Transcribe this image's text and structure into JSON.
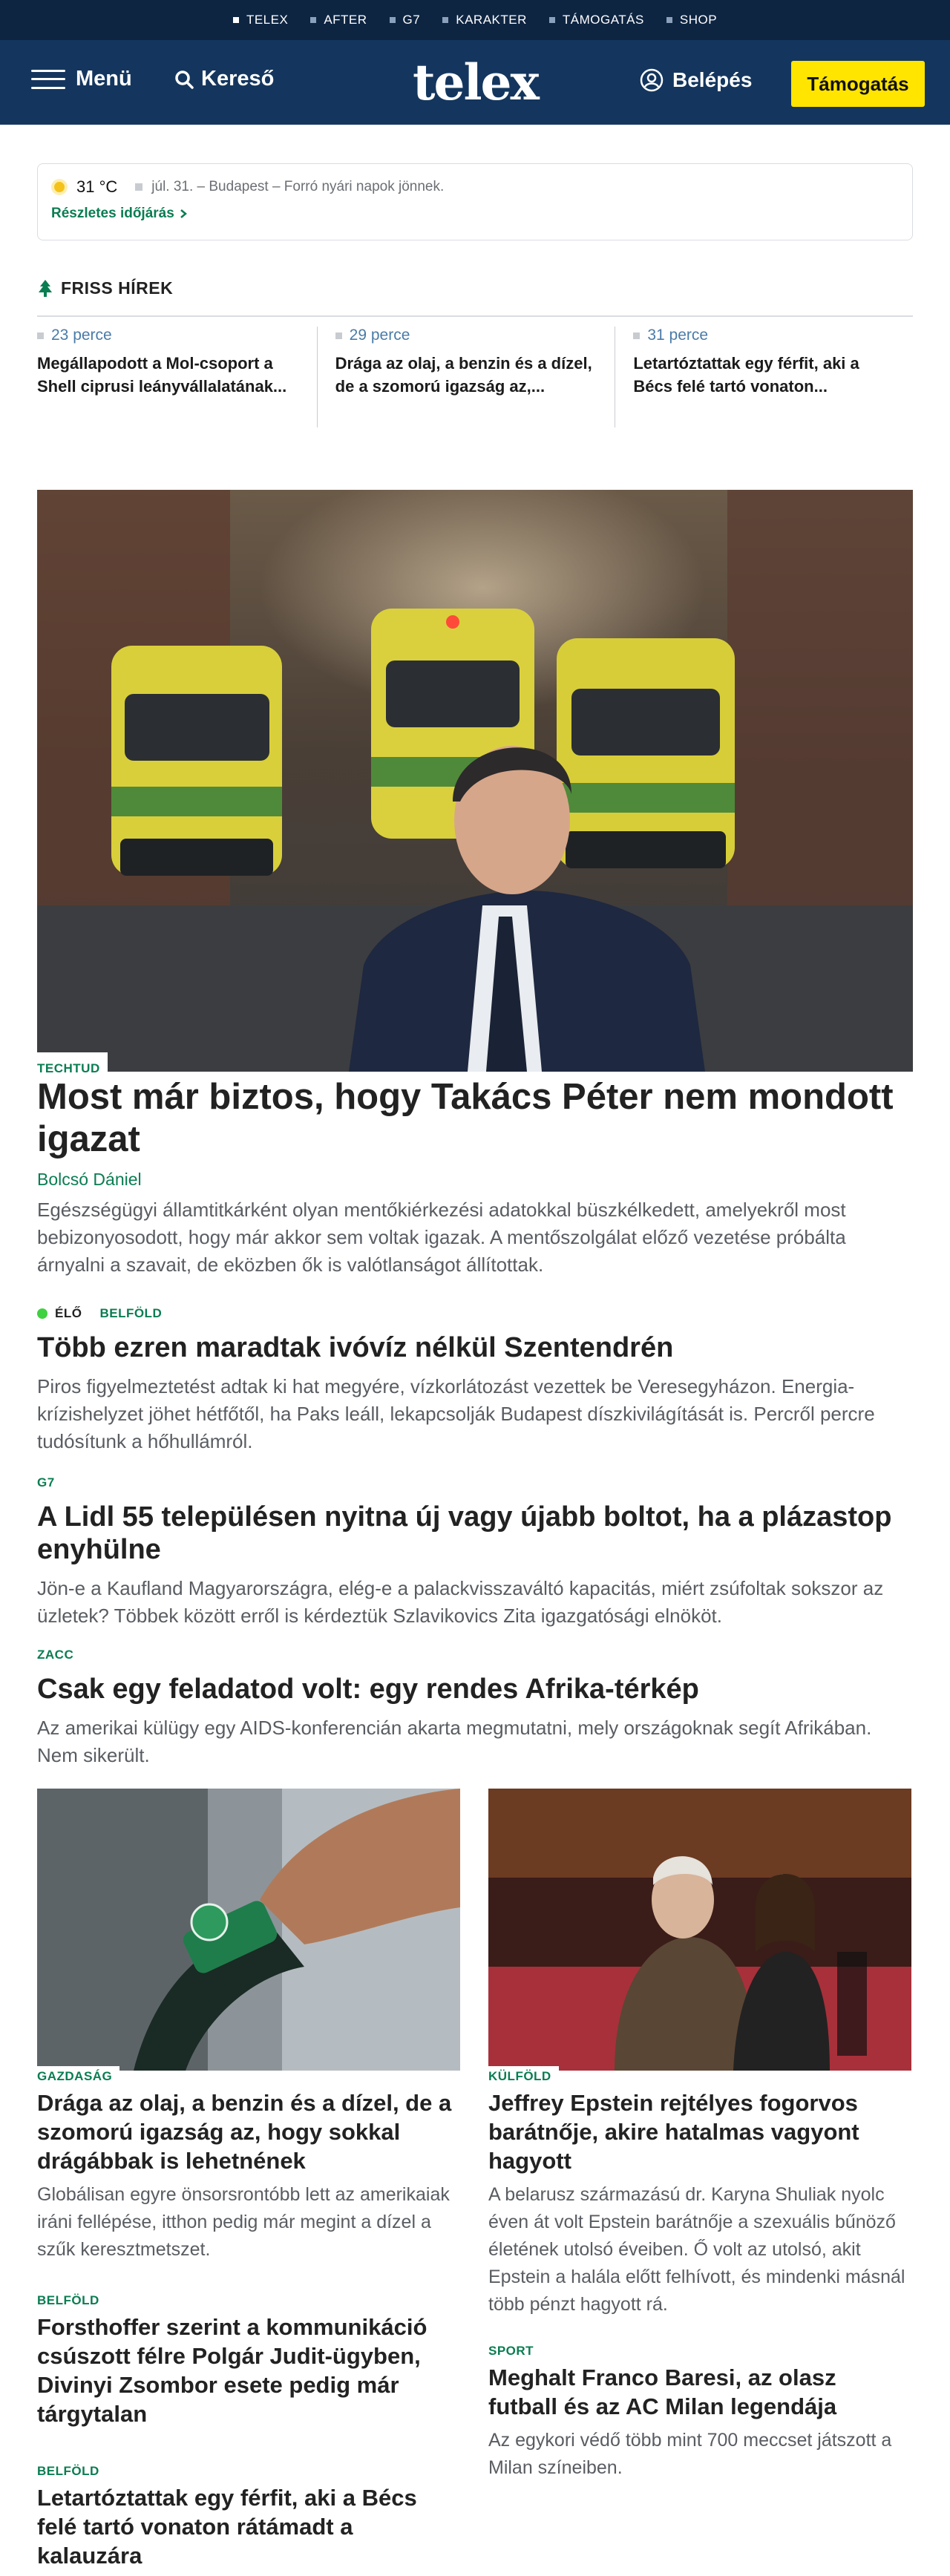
{
  "topnav": [
    "TELEX",
    "AFTER",
    "G7",
    "KARAKTER",
    "TÁMOGATÁS",
    "SHOP"
  ],
  "header": {
    "menu_label": "Menü",
    "search_label": "Kereső",
    "logo": "telex",
    "login_label": "Belépés",
    "support_label": "Támogatás"
  },
  "weather": {
    "temp": "31 °C",
    "text": "júl. 31. – Budapest – Forró nyári napok jönnek.",
    "link": "Részletes időjárás"
  },
  "friss": {
    "heading": "FRISS HÍREK",
    "items": [
      {
        "time": "23 perce",
        "title": "Megállapodott a Mol-csoport a Shell ciprusi leányvállalatának..."
      },
      {
        "time": "29 perce",
        "title": "Drága az olaj, a benzin és a dízel, de a szomorú igazság az,..."
      },
      {
        "time": "31 perce",
        "title": "Letartóztattak egy férfit, aki a Bécs felé tartó vonaton..."
      }
    ]
  },
  "lead": {
    "tag": "TECHTUD",
    "title": "Most már biztos, hogy Takács Péter nem mondott igazat",
    "author": "Bolcsó Dániel",
    "lead": "Egészségügyi államtitkárként olyan mentőkiérkezési adatokkal büszkélkedett, amelyekről most bebizonyosodott, hogy már akkor sem voltak igazak. A mentőszolgálat előző vezetése próbálta árnyalni a szavait, de eközben ők is valótlanságot állítottak."
  },
  "stories": [
    {
      "live": "ÉLŐ",
      "tag": "BELFÖLD",
      "title": "Több ezren maradtak ivóvíz nélkül Szentendrén",
      "lead": "Piros figyelmeztetést adtak ki hat megyére, vízkorlátozást vezettek be Veresegyházon. Energia-krízishelyzet jöhet hétfőtől, ha Paks leáll, lekapcsolják Budapest díszkivilágítását is. Percről percre tudósítunk a hőhullámról."
    },
    {
      "tag": "G7",
      "title": "A Lidl 55 településen nyitna új vagy újabb boltot, ha a plázastop enyhülne",
      "lead": "Jön-e a Kaufland Magyarországra, elég-e a palackvisszaváltó kapacitás, miért zsúfoltak sokszor az üzletek? Többek között erről is kérdeztük Szlavikovics Zita igazgatósági elnököt."
    },
    {
      "tag": "ZACC",
      "title": "Csak egy feladatod volt: egy rendes Afrika-térkép",
      "lead": "Az amerikai külügy egy AIDS-konferencián akarta megmutatni, mely országoknak segít Afrikában. Nem sikerült."
    }
  ],
  "left_col": [
    {
      "tag": "GAZDASÁG",
      "title": "Drága az olaj, a benzin és a dízel, de a szomorú igazság az, hogy sokkal drágábbak is lehetnének",
      "lead": "Globálisan egyre önsorsrontóbb lett az amerikaiak iráni fellépése, itthon pedig már megint a dízel a szűk keresztmetszet."
    },
    {
      "tag": "BELFÖLD",
      "title": "Forsthoffer szerint a kommunikáció csúszott félre Polgár Judit-ügyben, Divinyi Zsombor esete pedig már tárgytalan"
    },
    {
      "tag": "BELFÖLD",
      "title": "Letartóztattak egy férfit, aki a Bécs felé tartó vonaton rátámadt a kalauzára"
    }
  ],
  "right_col": [
    {
      "tag": "KÜLFÖLD",
      "title": "Jeffrey Epstein rejtélyes fogorvos barátnője, akire hatalmas vagyont hagyott",
      "lead": "A belarusz származású dr. Karyna Shuliak nyolc éven át volt Epstein barátnője a szexuális bűnöző életének utolsó éveiben. Ő volt az utolsó, akit Epstein a halála előtt felhívott, és mindenki másnál több pénzt hagyott rá."
    },
    {
      "tag": "SPORT",
      "title": "Meghalt Franco Baresi, az olasz futball és az AC Milan legendája",
      "lead": "Az egykori védő több mint 700 meccset játszott a Milan színeiben."
    }
  ]
}
